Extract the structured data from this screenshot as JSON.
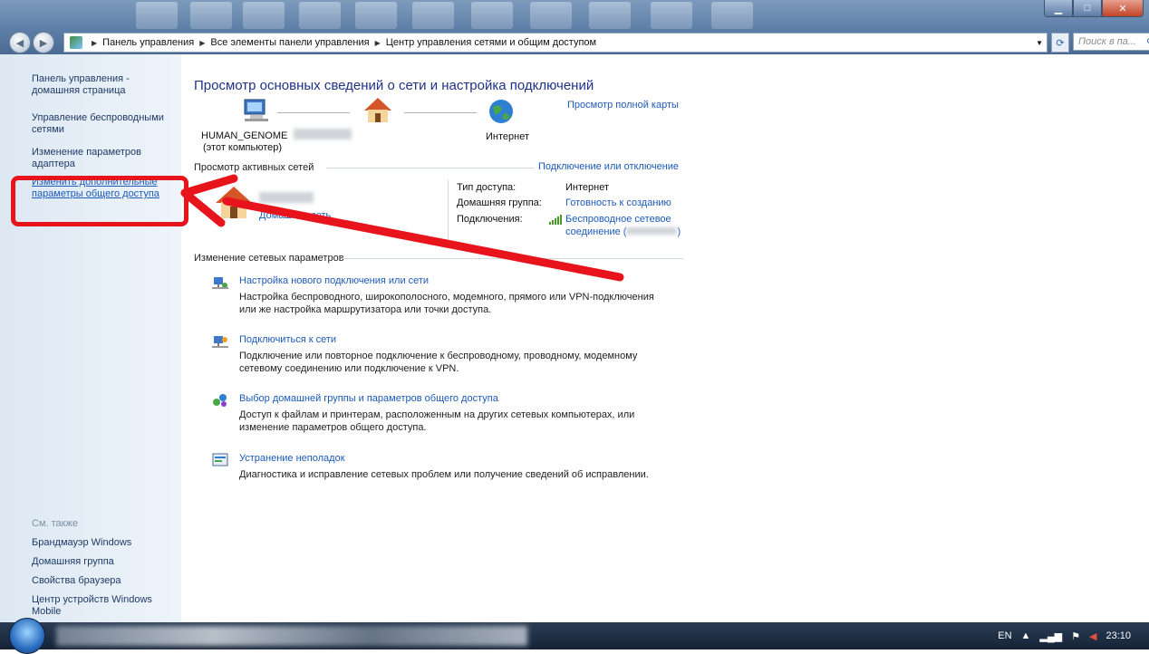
{
  "address_bar": {
    "crumbs": [
      "Панель управления",
      "Все элементы панели управления",
      "Центр управления сетями и общим доступом"
    ],
    "search_placeholder": "Поиск в па..."
  },
  "left_pane": {
    "home": "Панель управления - домашняя страница",
    "links": [
      "Управление беспроводными сетями",
      "Изменение параметров адаптера",
      "Изменить дополнительные параметры общего доступа"
    ],
    "see_also_label": "См. также",
    "see_also": [
      "Брандмауэр Windows",
      "Домашняя группа",
      "Свойства браузера",
      "Центр устройств Windows Mobile"
    ]
  },
  "main": {
    "title": "Просмотр основных сведений о сети и настройка подключений",
    "map": {
      "computer_name": "HUMAN_GENOME",
      "computer_sub": "(этот компьютер)",
      "internet": "Интернет",
      "full_map_link": "Просмотр полной карты"
    },
    "active": {
      "heading": "Просмотр активных сетей",
      "connect_link": "Подключение или отключение",
      "network_type": "Домашняя сеть",
      "access_type_label": "Тип доступа:",
      "access_type_value": "Интернет",
      "homegroup_label": "Домашняя группа:",
      "homegroup_value": "Готовность к созданию",
      "connections_label": "Подключения:",
      "connection_line1": "Беспроводное сетевое",
      "connection_line2a": "соединение (",
      "connection_line2b": ")"
    },
    "change_heading": "Изменение сетевых параметров",
    "tasks": [
      {
        "title": "Настройка нового подключения или сети",
        "desc1": "Настройка беспроводного, широкополосного, модемного, прямого или VPN-подключения",
        "desc2": "или же настройка маршрутизатора или точки доступа."
      },
      {
        "title": "Подключиться к сети",
        "desc1": "Подключение или повторное подключение к беспроводному, проводному, модемному",
        "desc2": "сетевому соединению или подключение к VPN."
      },
      {
        "title": "Выбор домашней группы и параметров общего доступа",
        "desc1": "Доступ к файлам и принтерам, расположенным на других сетевых компьютерах, или",
        "desc2": "изменение параметров общего доступа."
      },
      {
        "title": "Устранение неполадок",
        "desc1": "Диагностика и исправление сетевых проблем или получение сведений об исправлении.",
        "desc2": ""
      }
    ]
  },
  "taskbar": {
    "lang": "EN",
    "clock": "23:10"
  },
  "colors": {
    "link": "#1c5ab8",
    "title": "#1e3287",
    "highlight": "#e8141c"
  }
}
